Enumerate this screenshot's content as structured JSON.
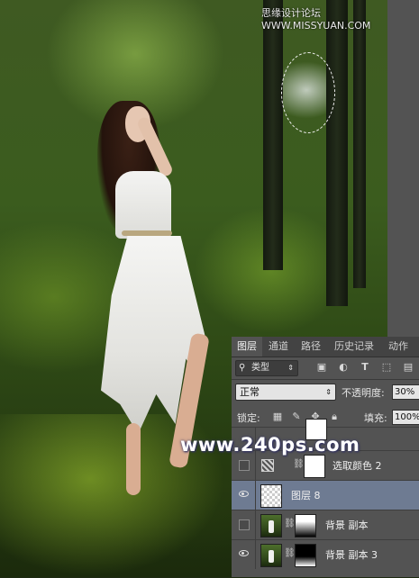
{
  "watermark": "思缘设计论坛 WWW.MISSYUAN.COM",
  "overlay_watermark": "www.240ps.com",
  "tabs": [
    {
      "label": "图层",
      "active": true
    },
    {
      "label": "通道",
      "active": false
    },
    {
      "label": "路径",
      "active": false
    },
    {
      "label": "历史记录",
      "active": false
    },
    {
      "label": "动作",
      "active": false
    }
  ],
  "filter": {
    "kind_label": "类型",
    "icons": [
      "image-filter-icon",
      "adjustment-filter-icon",
      "type-filter-icon",
      "shape-filter-icon",
      "smart-object-filter-icon"
    ]
  },
  "blend": {
    "mode": "正常",
    "opacity_label": "不透明度:",
    "opacity_value": "30%"
  },
  "lock": {
    "label": "锁定:",
    "fill_label": "填充:",
    "fill_value": "100%"
  },
  "layers": [
    {
      "name": "选取颜色 2",
      "visible": false,
      "type": "adjustment",
      "selected": false
    },
    {
      "name": "图层 8",
      "visible": true,
      "type": "transparent",
      "selected": true
    },
    {
      "name": "背景 副本",
      "visible": false,
      "type": "photo-with-mask",
      "selected": false
    },
    {
      "name": "背景 副本 3",
      "visible": true,
      "type": "photo-with-mask",
      "selected": false
    }
  ],
  "colors": {
    "panel_bg": "#535353",
    "selected_layer": "#6e7b92",
    "tab_bar": "#434343"
  }
}
